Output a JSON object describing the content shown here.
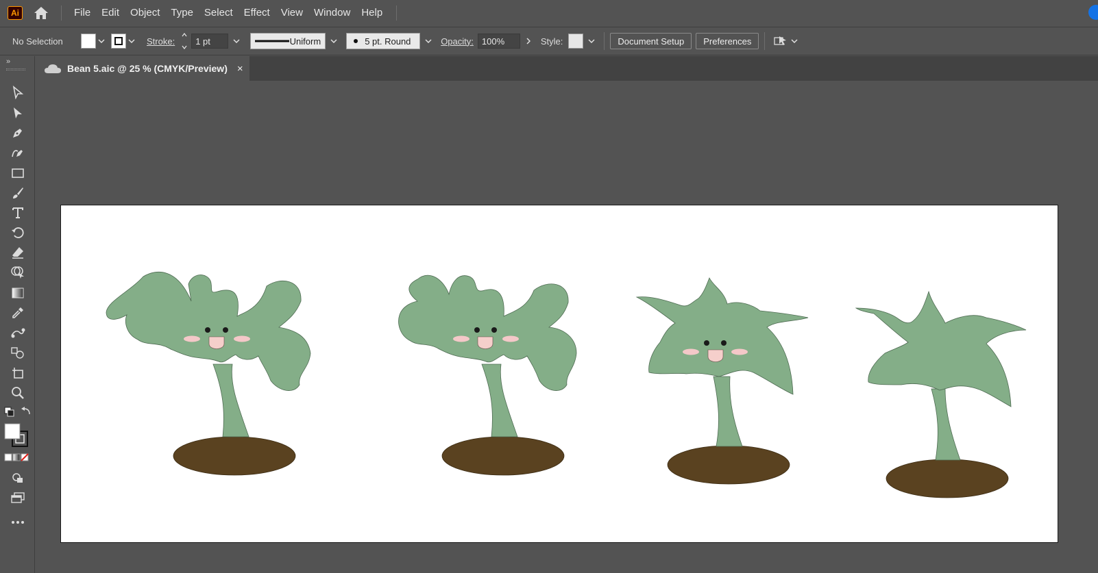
{
  "app": {
    "logo_text": "Ai"
  },
  "menu": {
    "items": [
      "File",
      "Edit",
      "Object",
      "Type",
      "Select",
      "Effect",
      "View",
      "Window",
      "Help"
    ]
  },
  "controls": {
    "selection_label": "No Selection",
    "stroke_label": "Stroke:",
    "stroke_weight": "1 pt",
    "stroke_profile": "Uniform",
    "brush_label": "5 pt. Round",
    "opacity_label": "Opacity:",
    "opacity_value": "100%",
    "style_label": "Style:",
    "document_setup": "Document Setup",
    "preferences": "Preferences"
  },
  "document": {
    "tab_title": "Bean 5.aic @ 25 % (CMYK/Preview)",
    "close_glyph": "×"
  },
  "artwork": {
    "description_colors": {
      "foliage": "#84ae88",
      "soil": "#5a4220",
      "cheeks": "#f4c8c8",
      "mouth": "#f5cfcb",
      "eyes": "#1a1a1a"
    },
    "plants": [
      {
        "name": "bean-sprout-curly-left",
        "has_face": true
      },
      {
        "name": "bean-sprout-curly",
        "has_face": true
      },
      {
        "name": "bean-sprout-star",
        "has_face": true
      },
      {
        "name": "bean-sprout-star-plain",
        "has_face": false
      }
    ]
  },
  "colors": {
    "ui_bg": "#535353",
    "tab_bg": "#424242",
    "accent": "#1473e6",
    "artboard": "#ffffff"
  }
}
